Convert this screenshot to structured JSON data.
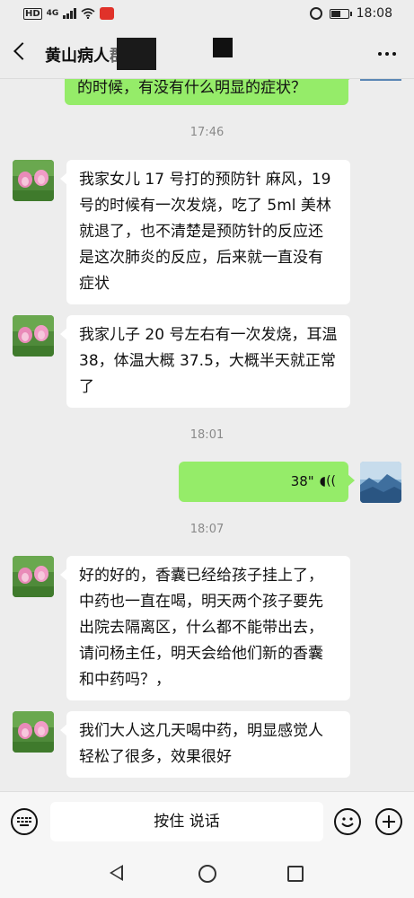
{
  "status_bar": {
    "network_label": "HD",
    "signal_label": "4G",
    "time": "18:08"
  },
  "header": {
    "title": "黄山病人",
    "title_partial": "群"
  },
  "messages": [
    {
      "type": "outgoing_text",
      "text": "的时候，有没有什么明显的症状？"
    },
    {
      "type": "time",
      "text": "17:46"
    },
    {
      "type": "incoming_text",
      "text": "我家女儿 17 号打的预防针 麻风，19 号的时候有一次发烧，吃了 5ml 美林就退了，也不清楚是预防针的反应还是这次肺炎的反应，后来就一直没有症状"
    },
    {
      "type": "incoming_text",
      "text": "我家儿子 20 号左右有一次发烧，耳温 38，体温大概 37.5，大概半天就正常了"
    },
    {
      "type": "time",
      "text": "18:01"
    },
    {
      "type": "outgoing_voice",
      "text": "38\""
    },
    {
      "type": "time",
      "text": "18:07"
    },
    {
      "type": "incoming_text",
      "text": "好的好的，香囊已经给孩子挂上了，中药也一直在喝，明天两个孩子要先出院去隔离区，什么都不能带出去，请问杨主任，明天会给他们新的香囊和中药吗？，"
    },
    {
      "type": "incoming_text",
      "text": "我们大人这几天喝中药，明显感觉人轻松了很多，效果很好"
    }
  ],
  "input_bar": {
    "hold_to_talk": "按住 说话"
  },
  "colors": {
    "background": "#ededed",
    "outgoing_bubble": "#95ec69",
    "incoming_bubble": "#ffffff",
    "timestamp": "#8a8a8a"
  }
}
